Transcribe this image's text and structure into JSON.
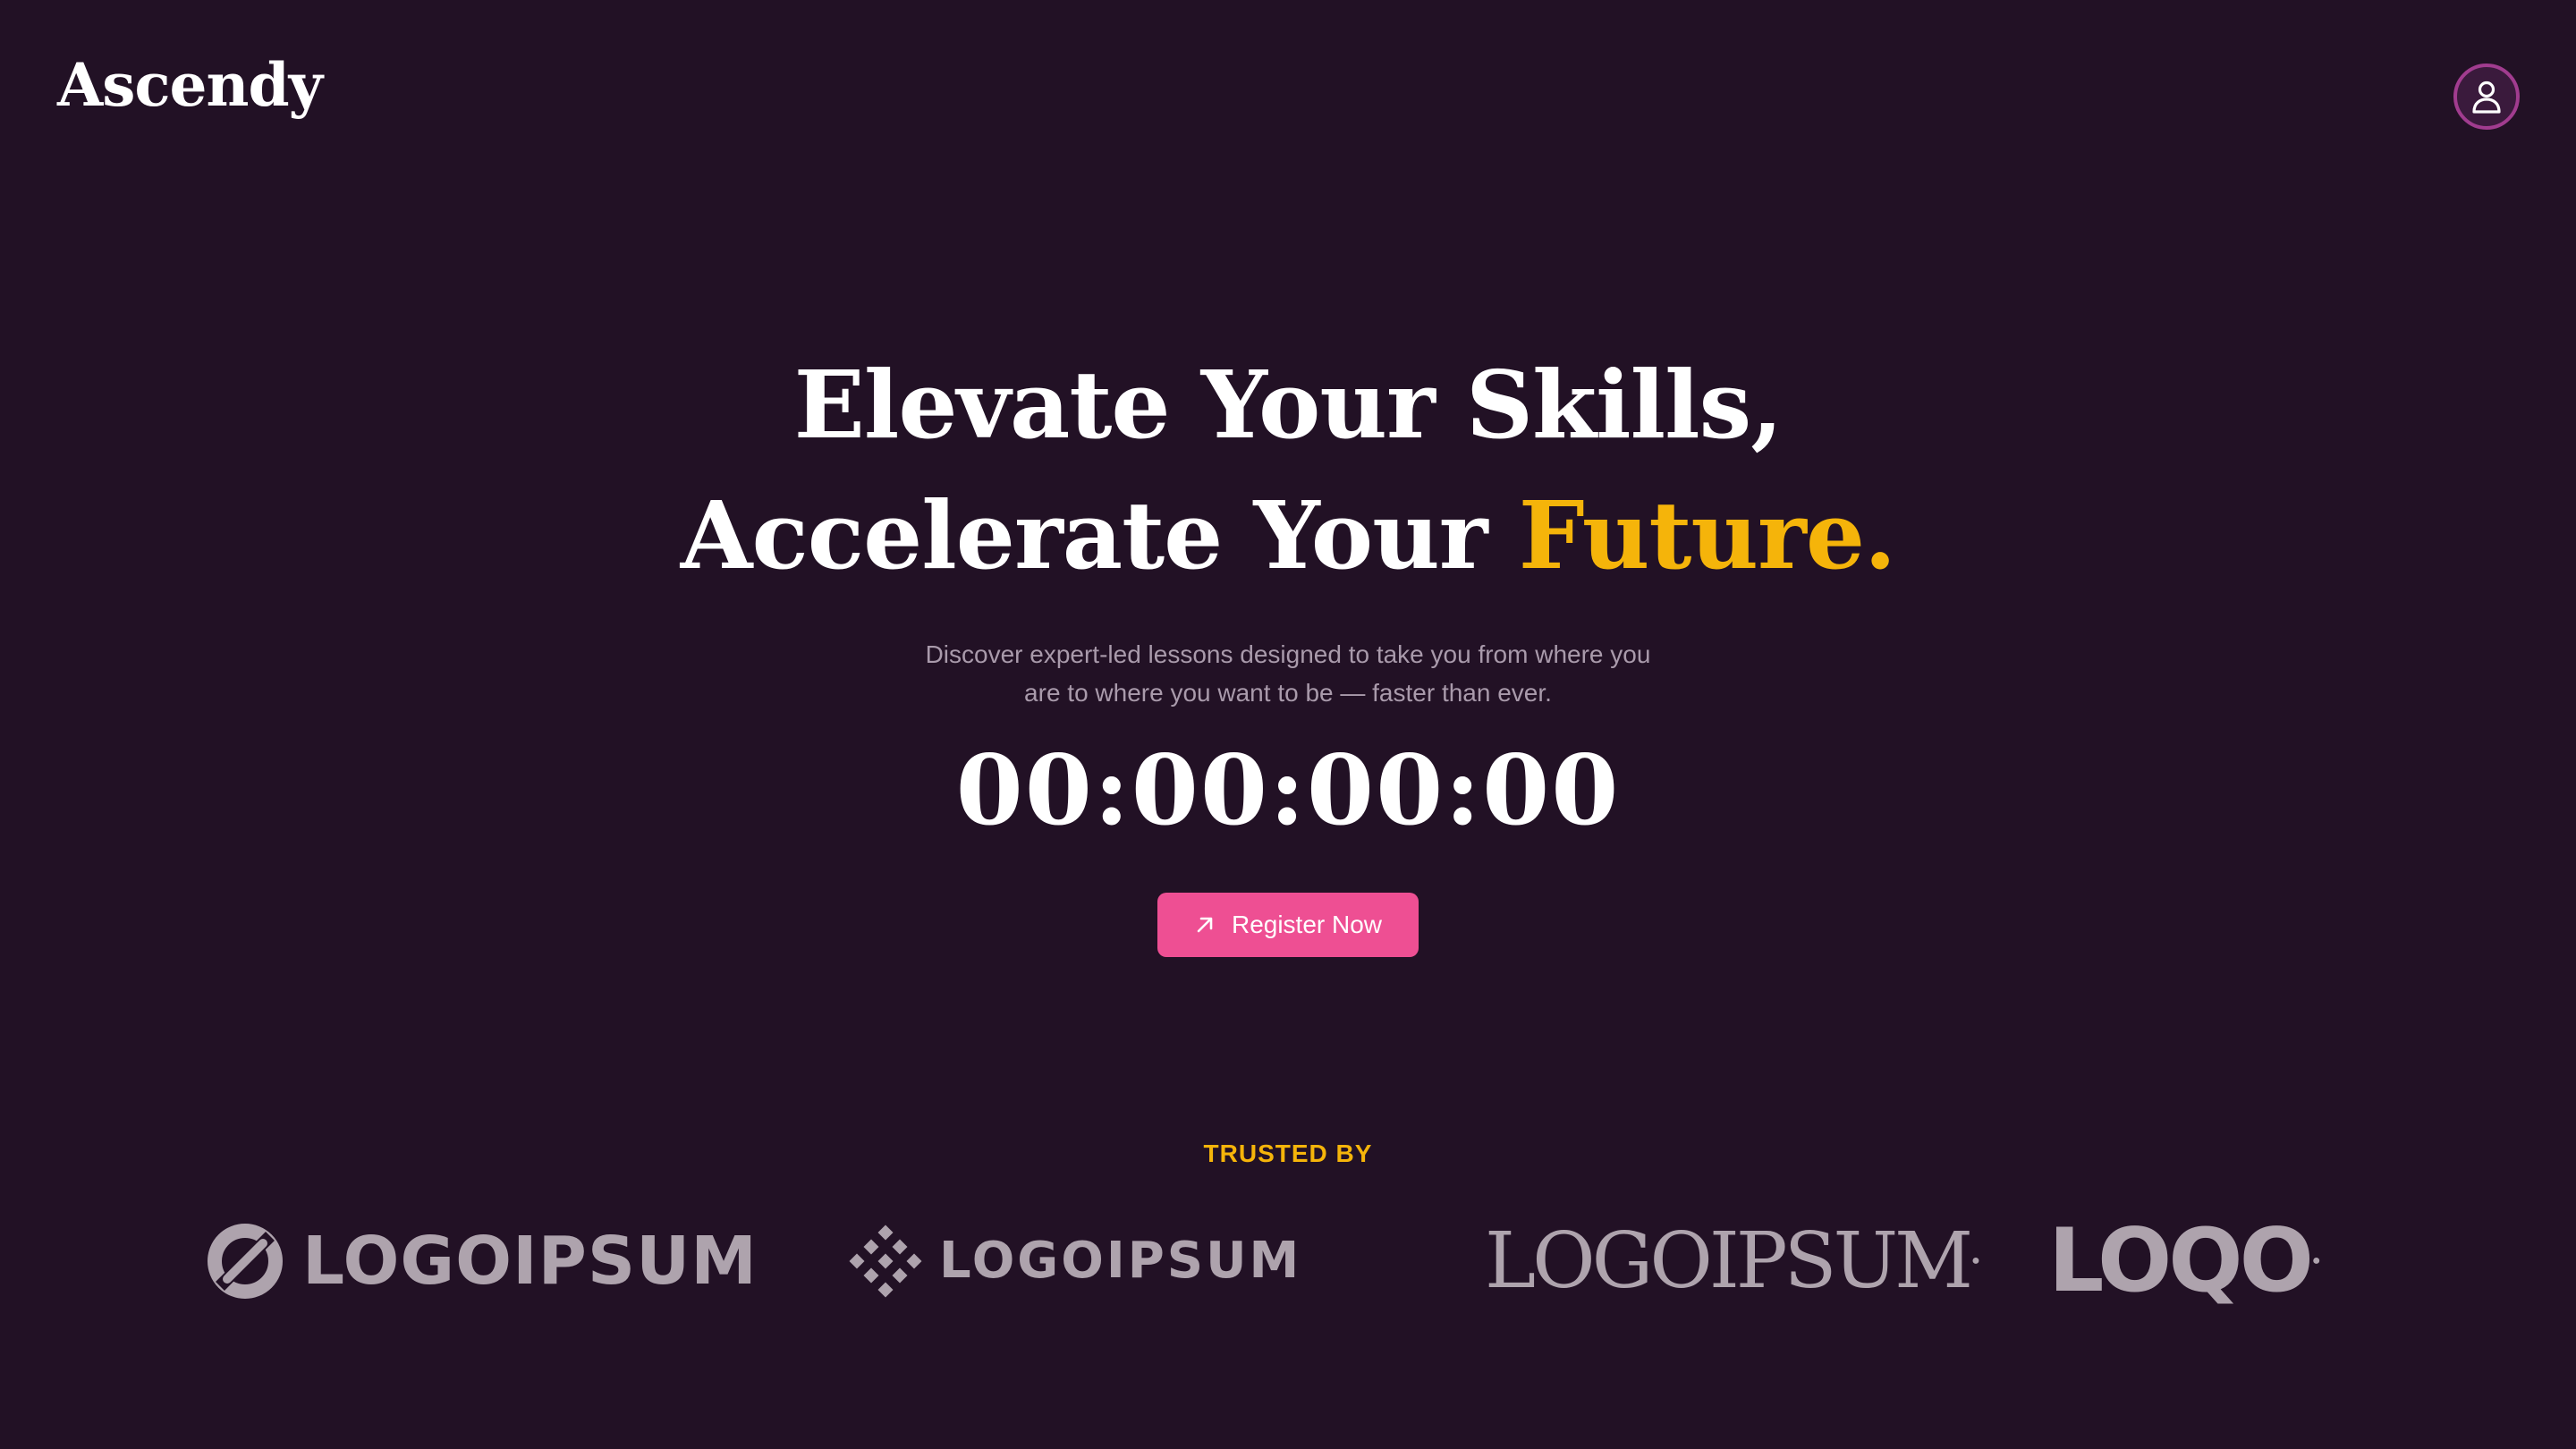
{
  "brand": {
    "name": "Ascendy"
  },
  "header": {
    "profile_icon": "user-icon"
  },
  "hero": {
    "line1": "Elevate Your Skills,",
    "line2_prefix": "Accelerate Your ",
    "line2_accent": "Future.",
    "subtitle_line1": "Discover expert-led lessons designed to take you from where you",
    "subtitle_line2": "are to where you want to be — faster than ever.",
    "countdown": "00:00:00:00",
    "cta_label": "Register Now",
    "cta_icon": "arrow-up-right-icon"
  },
  "trusted": {
    "heading": "TRUSTED BY",
    "logos": [
      {
        "text": "LOGOIPSUM",
        "icon": "circle-slash-logo-icon"
      },
      {
        "text": "LOGOIPSUM",
        "icon": "diamond-pattern-logo-icon"
      },
      {
        "text": "LOGOIPSUM",
        "icon": "sparkle-logo-icon"
      },
      {
        "text": "LOQO",
        "icon": "registered-mark"
      }
    ]
  },
  "colors": {
    "background": "#221125",
    "accent_yellow": "#f5b40a",
    "cta_pink": "#ee4f93",
    "avatar_ring": "#a13c8f",
    "muted_text": "#a99aab",
    "logo_gray": "#aea3ad"
  }
}
